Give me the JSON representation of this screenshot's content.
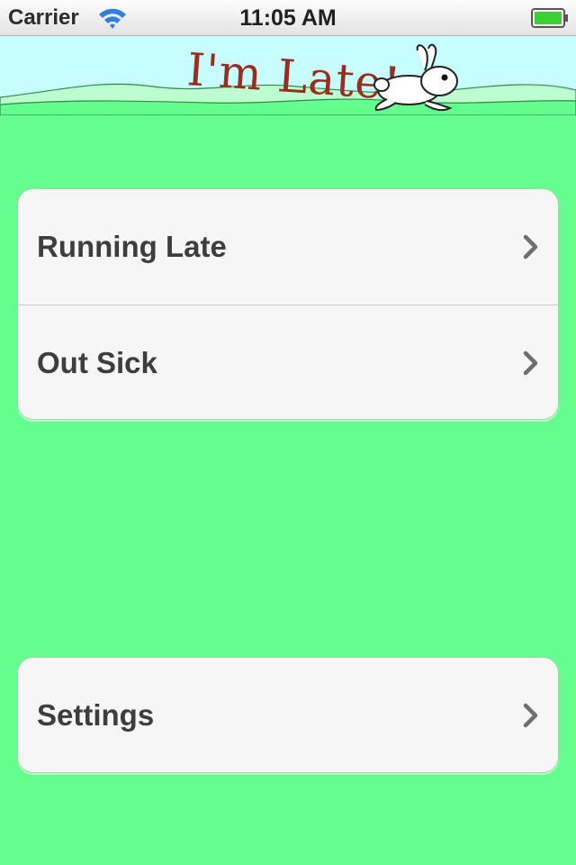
{
  "status_bar": {
    "carrier": "Carrier",
    "time": "11:05 AM",
    "signal_icon": "wifi-icon",
    "battery_icon": "battery-icon",
    "battery_color": "#3bd132"
  },
  "header": {
    "logo_text": "I'm Late!",
    "mascot_icon": "rabbit-icon",
    "sky_color": "#c8fdfd",
    "hill_color": "#63fe8d",
    "logo_color": "#9b2d20"
  },
  "menu": {
    "items": [
      {
        "label": "Running Late",
        "icon": "chevron-right-icon"
      },
      {
        "label": "Out Sick",
        "icon": "chevron-right-icon"
      }
    ]
  },
  "settings": {
    "label": "Settings",
    "icon": "chevron-right-icon"
  },
  "colors": {
    "background": "#63fe8d",
    "cell_background": "#f6f6f6",
    "cell_text": "#3d3d3d",
    "chevron": "#6e6e6e"
  }
}
